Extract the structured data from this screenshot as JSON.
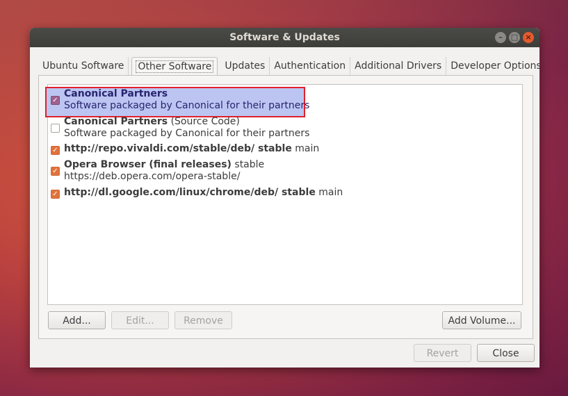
{
  "window": {
    "title": "Software & Updates"
  },
  "tabs": [
    {
      "label": "Ubuntu Software"
    },
    {
      "label": "Other Software"
    },
    {
      "label": "Updates"
    },
    {
      "label": "Authentication"
    },
    {
      "label": "Additional Drivers"
    },
    {
      "label": "Developer Options"
    }
  ],
  "sources": [
    {
      "title": "Canonical Partners",
      "suffix": "",
      "subtitle": "Software packaged by Canonical for their partners",
      "checked": true
    },
    {
      "title": "Canonical Partners",
      "suffix": " (Source Code)",
      "subtitle": "Software packaged by Canonical for their partners",
      "checked": false
    },
    {
      "title": "http://repo.vivaldi.com/stable/deb/ stable",
      "suffix": " main",
      "subtitle": "",
      "checked": true
    },
    {
      "title": "Opera Browser (final releases)",
      "suffix": " stable",
      "subtitle": "https://deb.opera.com/opera-stable/",
      "checked": true
    },
    {
      "title": "http://dl.google.com/linux/chrome/deb/ stable",
      "suffix": " main",
      "subtitle": "",
      "checked": true
    }
  ],
  "buttons": {
    "add": "Add...",
    "edit": "Edit...",
    "remove": "Remove",
    "add_volume": "Add Volume...",
    "revert": "Revert",
    "close": "Close"
  },
  "icons": {
    "check": "✓",
    "minimize": "–",
    "maximize": "□",
    "close": "×"
  },
  "colors": {
    "accent": "#e0733c",
    "selection": "#bcc5f2",
    "highlight_border": "#e0202a"
  }
}
